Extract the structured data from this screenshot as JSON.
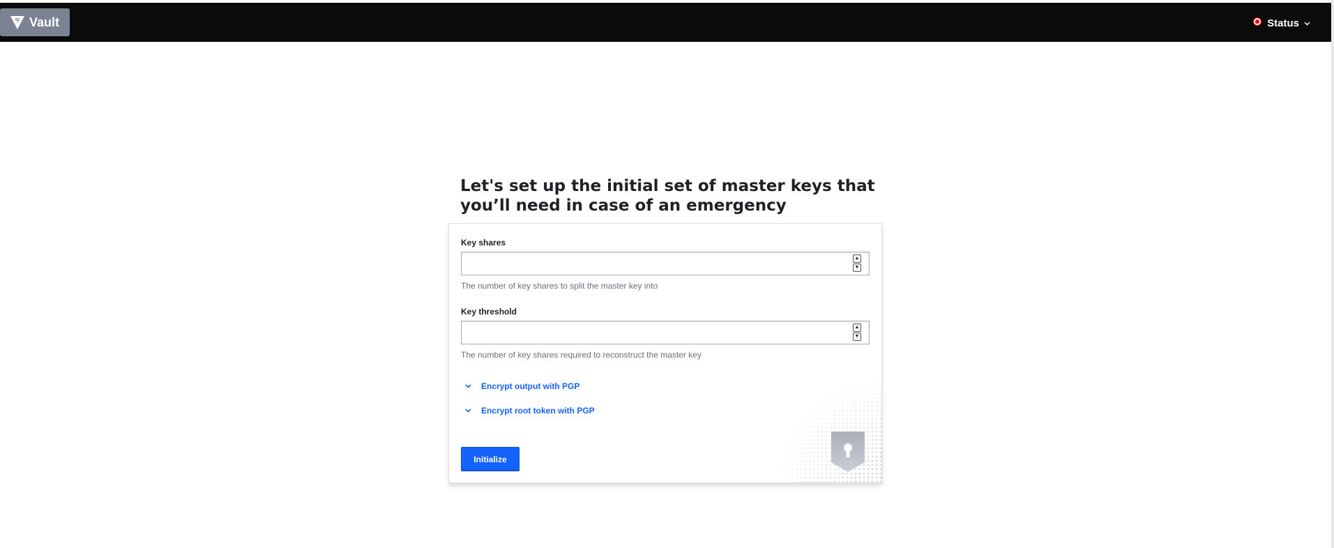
{
  "header": {
    "brand_label": "Vault",
    "status_label": "Status",
    "status_color": "#f40000"
  },
  "main": {
    "title": "Let's set up the initial set of master keys that you’ll need in case of an emergency"
  },
  "form": {
    "key_shares": {
      "label": "Key shares",
      "value": "",
      "help": "The number of key shares to split the master key into"
    },
    "key_threshold": {
      "label": "Key threshold",
      "value": "",
      "help": "The number of key shares required to reconstruct the master key"
    },
    "toggles": [
      {
        "label": "Encrypt output with PGP",
        "icon": "chevron-down-icon"
      },
      {
        "label": "Encrypt root token with PGP",
        "icon": "chevron-down-icon"
      }
    ],
    "submit_label": "Initialize",
    "accent_color": "#1563ff"
  },
  "icons": {
    "brand": "vault-logo-icon",
    "status_dropdown": "chevron-down-icon",
    "illustration": "keyhole-shield-icon"
  }
}
